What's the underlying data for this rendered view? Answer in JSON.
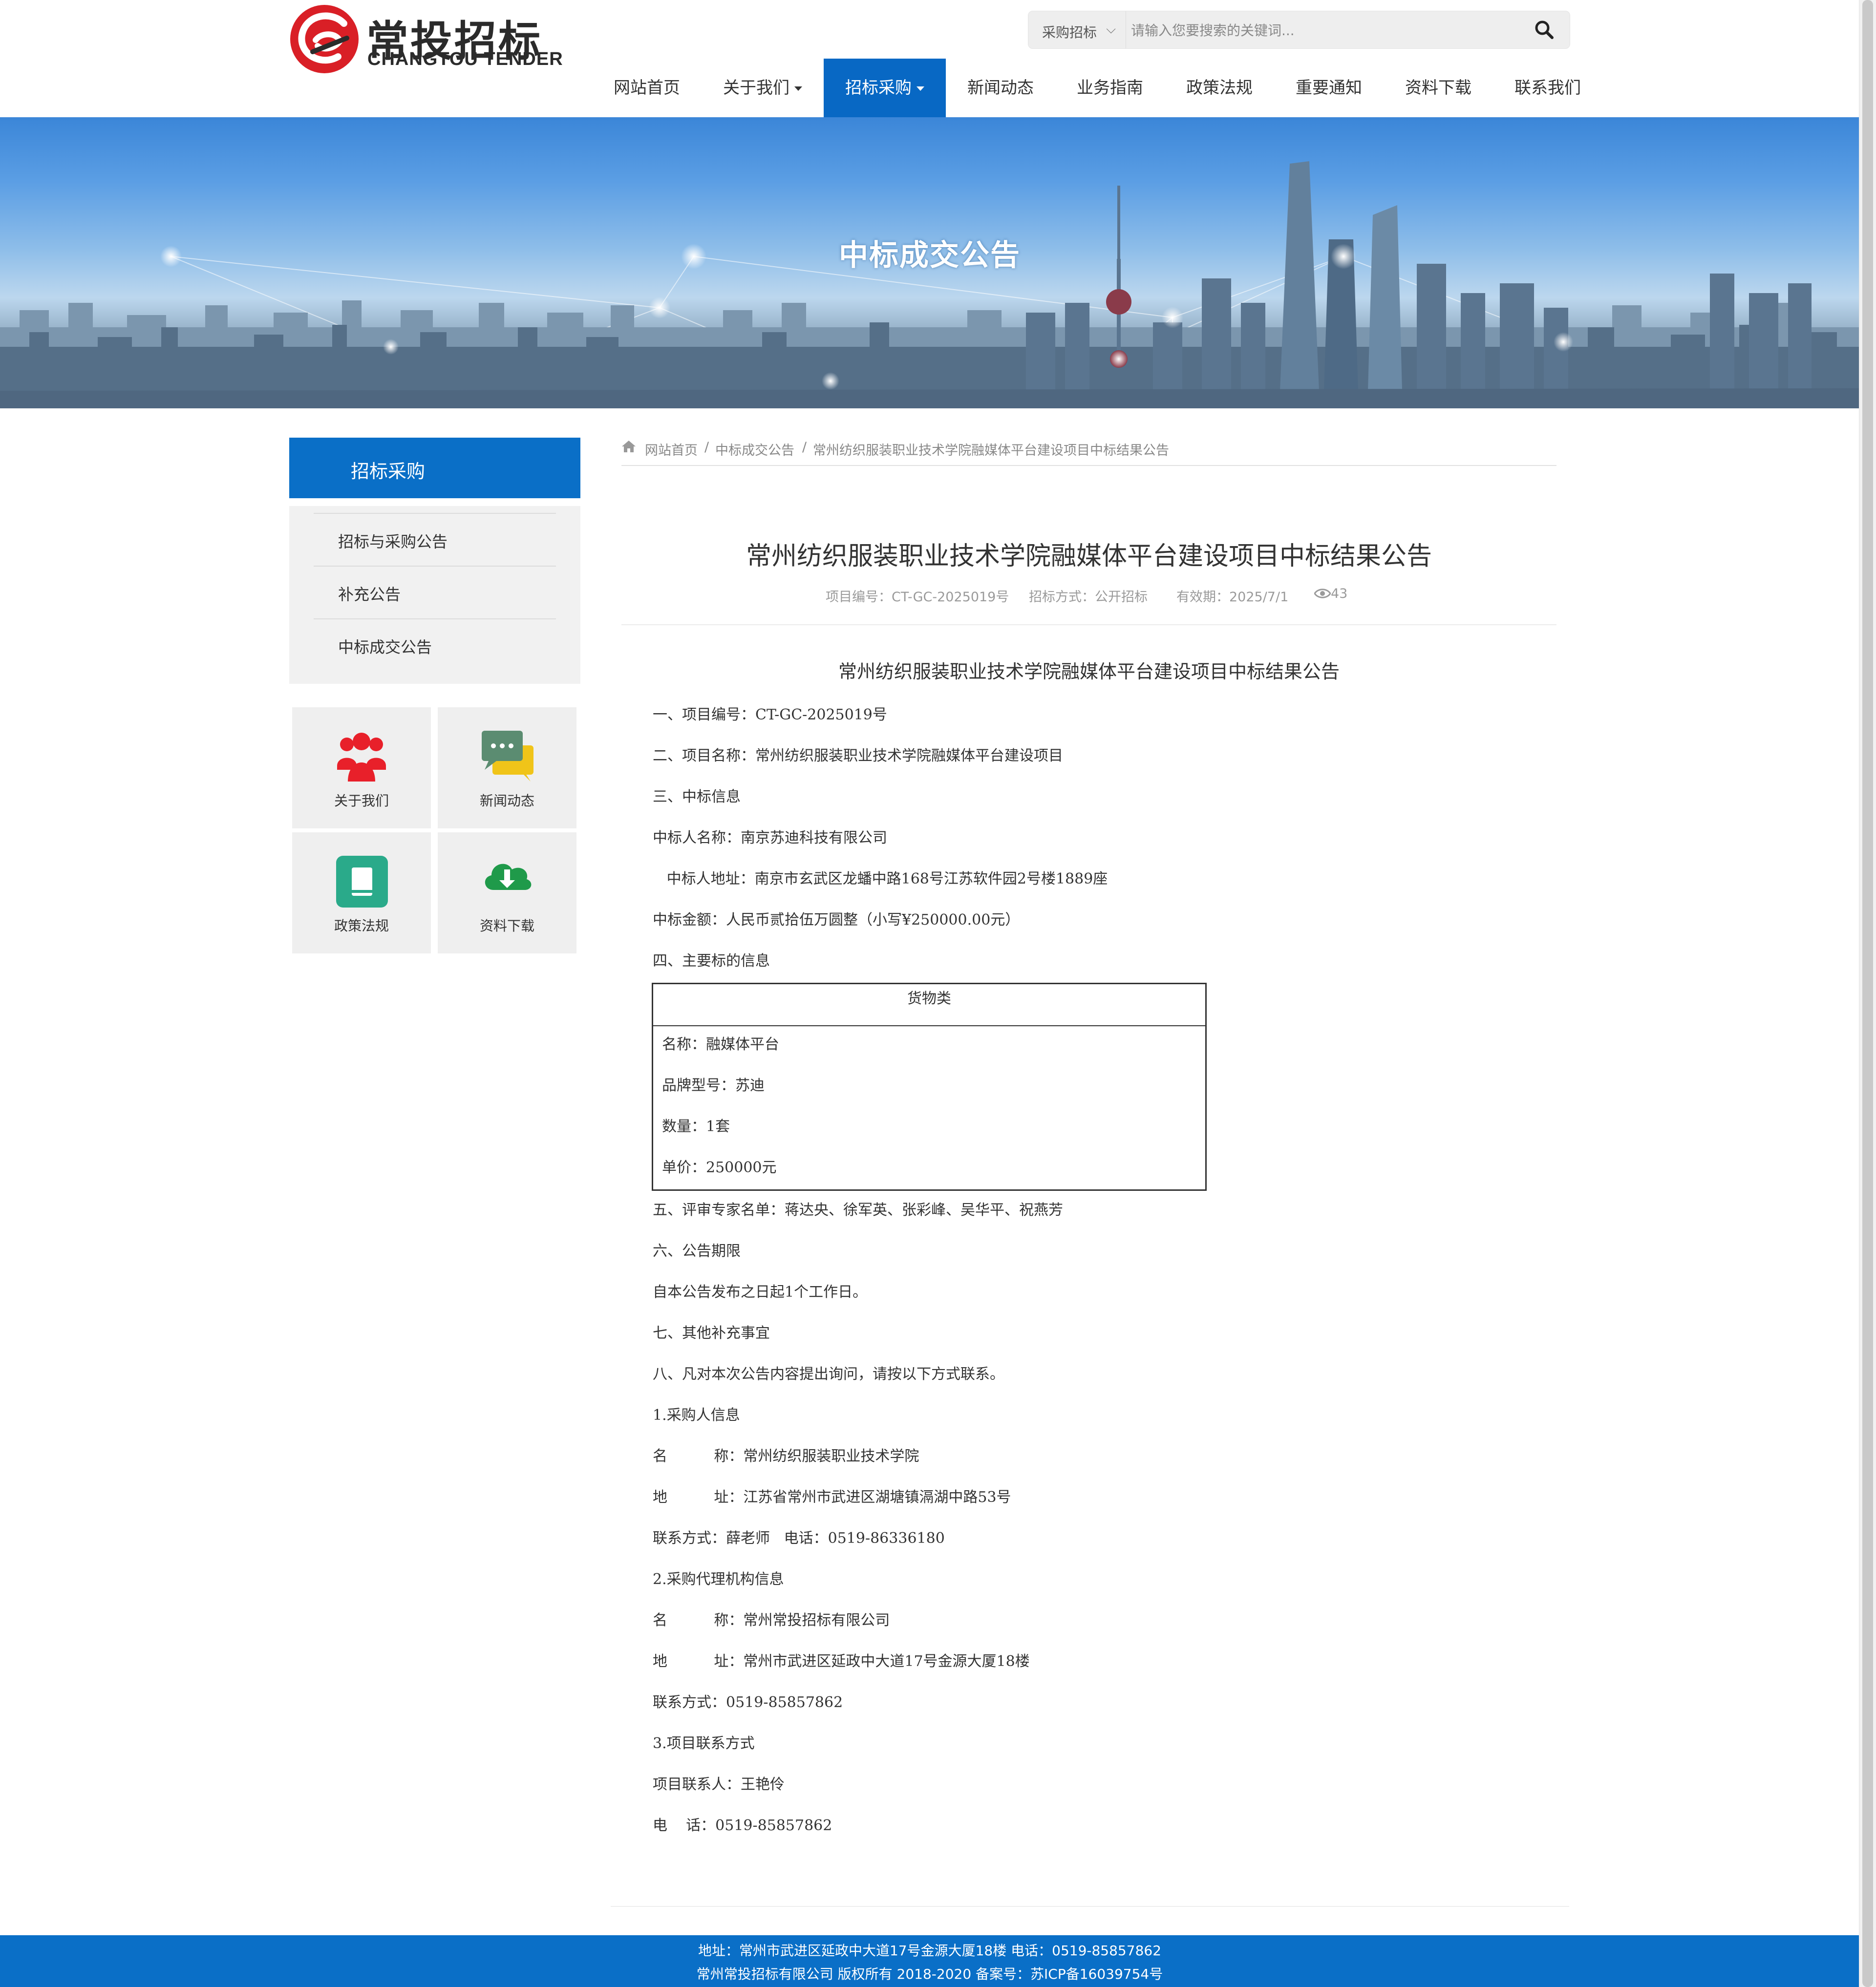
{
  "header": {
    "logo_cn": "常投招标",
    "logo_en": "CHANGTOU TENDER",
    "search": {
      "category": "采购招标",
      "placeholder": "请输入您要搜索的关键词..."
    },
    "nav": [
      {
        "label": "网站首页"
      },
      {
        "label": "关于我们"
      },
      {
        "label": "招标采购"
      },
      {
        "label": "新闻动态"
      },
      {
        "label": "业务指南"
      },
      {
        "label": "政策法规"
      },
      {
        "label": "重要通知"
      },
      {
        "label": "资料下载"
      },
      {
        "label": "联系我们"
      }
    ],
    "accent": "#0868c4"
  },
  "banner": {
    "title": "中标成交公告"
  },
  "sidebar": {
    "title": "招标采购",
    "items": [
      {
        "label": "招标与采购公告"
      },
      {
        "label": "补充公告"
      },
      {
        "label": "中标成交公告"
      }
    ],
    "quick_links": [
      {
        "label": "关于我们",
        "icon": "users-icon",
        "color": "#e8202a"
      },
      {
        "label": "新闻动态",
        "icon": "chat-icon",
        "color": "#5b8c71"
      },
      {
        "label": "政策法规",
        "icon": "book-icon",
        "color": "#2aaa8a"
      },
      {
        "label": "资料下载",
        "icon": "cloud-download-icon",
        "color": "#1f9a4a"
      }
    ]
  },
  "breadcrumb": {
    "home": "网站首页",
    "sep": "/",
    "section": "中标成交公告",
    "current": "常州纺织服装职业技术学院融媒体平台建设项目中标结果公告"
  },
  "article": {
    "title": "常州纺织服装职业技术学院融媒体平台建设项目中标结果公告",
    "project_no": "项目编号：CT-GC-2025019号",
    "method": "招标方式：公开招标",
    "validity": "有效期：2025/7/1",
    "views": "43"
  },
  "doc": {
    "title": "常州纺织服装职业技术学院融媒体平台建设项目中标结果公告",
    "lines_a": [
      "一、项目编号：CT-GC-2025019号",
      "二、项目名称：常州纺织服装职业技术学院融媒体平台建设项目",
      "三、中标信息",
      "中标人名称：南京苏迪科技有限公司",
      "   中标人地址：南京市玄武区龙蟠中路168号江苏软件园2号楼1889座",
      "中标金额：人民币贰拾伍万圆整（小写¥250000.00元）",
      "四、主要标的信息"
    ],
    "table": {
      "header": "货物类",
      "rows": [
        "名称：融媒体平台",
        "品牌型号：苏迪",
        "数量：1套",
        "单价：250000元"
      ]
    },
    "lines_b": [
      "五、评审专家名单：蒋达央、徐军英、张彩峰、吴华平、祝燕芳",
      "六、公告期限",
      "自本公告发布之日起1个工作日。",
      "七、其他补充事宜",
      "八、凡对本次公告内容提出询问，请按以下方式联系。",
      "1.采购人信息",
      "名          称：常州纺织服装职业技术学院",
      "地          址：江苏省常州市武进区湖塘镇滆湖中路53号",
      "联系方式：薛老师   电话：0519-86336180",
      "2.采购代理机构信息",
      "名          称：常州常投招标有限公司",
      "地          址：常州市武进区延政中大道17号金源大厦18楼",
      "联系方式：0519-85857862",
      "3.项目联系方式",
      "项目联系人：王艳伶",
      "电    话：0519-85857862"
    ]
  },
  "footer": {
    "line1": "地址：常州市武进区延政中大道17号金源大厦18楼  电话：0519-85857862",
    "line2": "常州常投招标有限公司 版权所有 2018-2020   备案号：苏ICP备16039754号"
  }
}
